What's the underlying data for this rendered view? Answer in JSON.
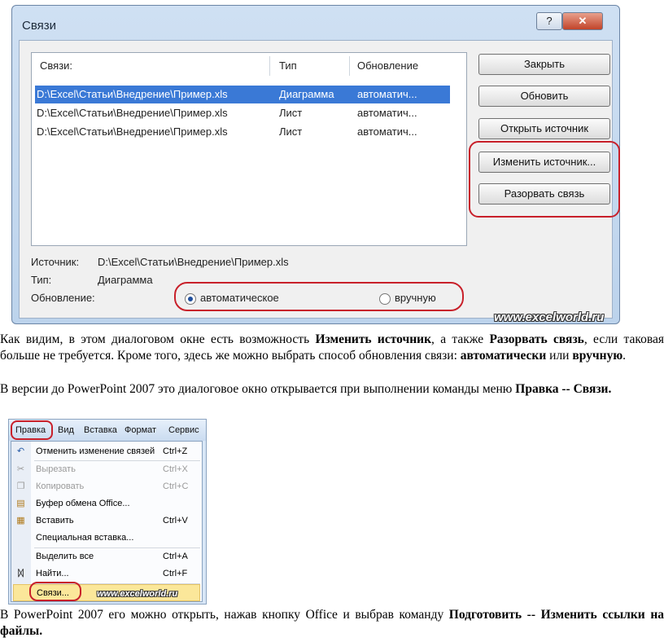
{
  "dialog": {
    "title": "Связи",
    "help_btn": "?",
    "close_btn": "✕",
    "columns": [
      "Связи:",
      "Тип",
      "Обновление"
    ],
    "rows": [
      {
        "path": "D:\\Excel\\Статьи\\Внедрение\\Пример.xls",
        "type": "Диаграмма",
        "update": "автоматич..."
      },
      {
        "path": "D:\\Excel\\Статьи\\Внедрение\\Пример.xls",
        "type": "Лист",
        "update": "автоматич..."
      },
      {
        "path": "D:\\Excel\\Статьи\\Внедрение\\Пример.xls",
        "type": "Лист",
        "update": "автоматич..."
      }
    ],
    "buttons": {
      "close": "Закрыть",
      "update": "Обновить",
      "open_source": "Открыть источник",
      "change_source": "Изменить источник...",
      "break_link": "Разорвать связь"
    },
    "source_label": "Источник:",
    "source_value": "D:\\Excel\\Статьи\\Внедрение\\Пример.xls",
    "type_label": "Тип:",
    "type_value": "Диаграмма",
    "update_label": "Обновление:",
    "radio_auto": "автоматическое",
    "radio_manual": "вручную",
    "watermark": "www.excelworld.ru"
  },
  "text1": {
    "p1": "Как видим, в этом диалоговом окне есть возможность ",
    "b1": "Изменить источник",
    "p2": ", а также ",
    "b2": "Разорвать связь",
    "p3": ", если таковая больше не требуется. Кроме того, здесь же можно выбрать способ обновления связи: ",
    "b3": "автоматически",
    "p4": " или ",
    "b4": "вручную",
    "p5": "."
  },
  "text2": {
    "p1": "В версии до PowerPoint 2007 это диалоговое окно открывается при выполнении команды меню ",
    "b1": "Правка -- Связи."
  },
  "menu": {
    "bar": [
      "Правка",
      "Вид",
      "Вставка",
      "Формат",
      "Сервис"
    ],
    "items": [
      {
        "label": "Отменить изменение связей",
        "shortcut": "Ctrl+Z",
        "icon": "undo-icon",
        "glyph": "↶"
      },
      {
        "label": "Вырезать",
        "shortcut": "Ctrl+X",
        "icon": "cut-icon",
        "glyph": "✂"
      },
      {
        "label": "Копировать",
        "shortcut": "Ctrl+C",
        "icon": "copy-icon",
        "glyph": "❐"
      },
      {
        "label": "Буфер обмена Office...",
        "shortcut": "",
        "icon": "clipboard-icon",
        "glyph": "▤"
      },
      {
        "label": "Вставить",
        "shortcut": "Ctrl+V",
        "icon": "paste-icon",
        "glyph": "▦"
      },
      {
        "label": "Специальная вставка...",
        "shortcut": "",
        "icon": "",
        "glyph": ""
      },
      {
        "label": "Выделить все",
        "shortcut": "Ctrl+A",
        "icon": "",
        "glyph": ""
      },
      {
        "label": "Найти...",
        "shortcut": "Ctrl+F",
        "icon": "binoculars-icon",
        "glyph": "ᛞ"
      },
      {
        "label": "Связи...",
        "shortcut": "",
        "icon": "",
        "glyph": ""
      }
    ],
    "watermark": "www.excelworld.ru"
  },
  "text3": {
    "p1": "В PowerPoint 2007 его можно открыть, нажав кнопку Office и выбрав команду ",
    "b1": "Подготовить -- Изменить ссылки на файлы."
  },
  "colors": {
    "highlight": "#c8202a",
    "selection": "#3a79d6"
  }
}
